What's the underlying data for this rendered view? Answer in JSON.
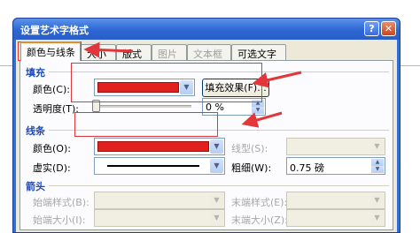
{
  "window": {
    "title": "设置艺术字格式",
    "help_label": "?",
    "close_label": "✕"
  },
  "tabs": [
    {
      "label": "颜色与线条",
      "state": "active"
    },
    {
      "label": "大小",
      "state": "normal"
    },
    {
      "label": "版式",
      "state": "normal"
    },
    {
      "label": "图片",
      "state": "disabled"
    },
    {
      "label": "文本框",
      "state": "disabled"
    },
    {
      "label": "可选文字",
      "state": "normal"
    }
  ],
  "fill": {
    "header": "填充",
    "color_label": "颜色(C):",
    "color_value": "#e1211e",
    "effects_button": "填充效果(F)...",
    "transparency_label": "透明度(T):",
    "transparency_value": "0 %"
  },
  "line": {
    "header": "线条",
    "color_label": "颜色(O):",
    "color_value": "#e1211e",
    "linetype_label": "线型(S):",
    "dash_label": "虚实(D):",
    "weight_label": "粗细(W):",
    "weight_value": "0.75 磅"
  },
  "arrows": {
    "header": "箭头",
    "begin_style_label": "始端样式(B):",
    "end_style_label": "末端样式(E):",
    "begin_size_label": "始端大小(I):",
    "end_size_label": "末端大小(Z):"
  },
  "annotation_color": "#e3363a",
  "icons": {
    "dropdown": "chevron-down-icon",
    "spin_up": "triangle-up-icon",
    "spin_down": "triangle-down-icon"
  }
}
